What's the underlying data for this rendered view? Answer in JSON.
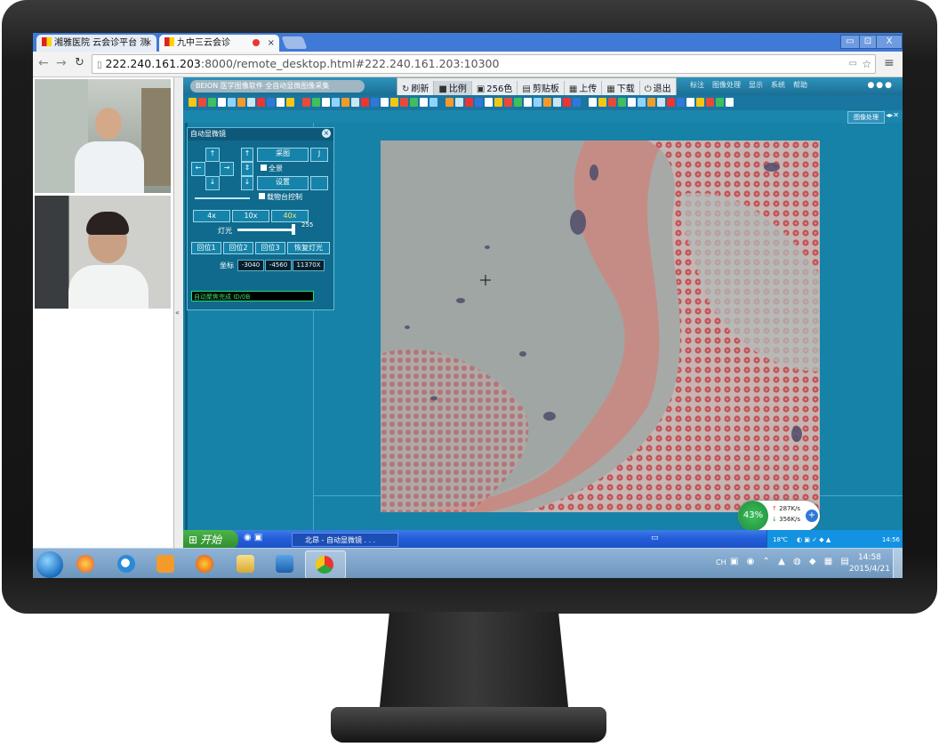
{
  "browser": {
    "tabs": [
      {
        "label": "湘雅医院 云会诊平台 测"
      },
      {
        "label": "九中三云会诊"
      }
    ],
    "url_host": "222.240.161.203",
    "url_rest": ":8000/remote_desktop.html#222.240.161.203:10300",
    "window_controls": [
      "▭",
      "⊡",
      "X"
    ]
  },
  "app": {
    "brand": "BEION 医学图像软件  全自动显微图像采集",
    "top_buttons": [
      {
        "icon": "↻",
        "label": "刷新"
      },
      {
        "icon": "■",
        "label": "比例"
      },
      {
        "icon": "▣",
        "label": "256色"
      },
      {
        "icon": "▤",
        "label": "剪贴板"
      },
      {
        "icon": "▦",
        "label": "上传"
      },
      {
        "icon": "▦",
        "label": "下载"
      },
      {
        "icon": "⏻",
        "label": "退出"
      }
    ],
    "menu": [
      "标注",
      "图像处理",
      "显示",
      "系统",
      "帮助"
    ],
    "right_tab": "图像处理"
  },
  "panel": {
    "title": "自动显微镜",
    "btn_capture": "采图",
    "btn_j": "J",
    "chk_full": "全景",
    "btn_setting": "设置",
    "chk_stage": "载物台控制",
    "magnifications": [
      "4x",
      "10x",
      "40x"
    ],
    "light_label": "灯光",
    "light_value": "255",
    "light_level": 1.0,
    "positions": [
      "回位1",
      "回位2",
      "回位3",
      "恢复灯光"
    ],
    "coord_label": "坐标",
    "coord_values": [
      "-3040",
      "-4560",
      "11370X"
    ],
    "status": "自动聚焦完成 ID/0B"
  },
  "speed": {
    "percent": "43%",
    "up": "287K/s",
    "down": "356K/s"
  },
  "xp": {
    "start": "开始",
    "app": "北昂 - 自动显微镜 . . .",
    "temp": "18℃",
    "time": "14:56"
  },
  "win7": {
    "tray_lang": "CH",
    "time": "14:58",
    "date": "2015/4/21"
  },
  "colors": {
    "accent": "#1782a8",
    "xp_taskbar": "#245edc",
    "win7_taskbar": "#6c95bd",
    "status_green": "#35e06a"
  }
}
